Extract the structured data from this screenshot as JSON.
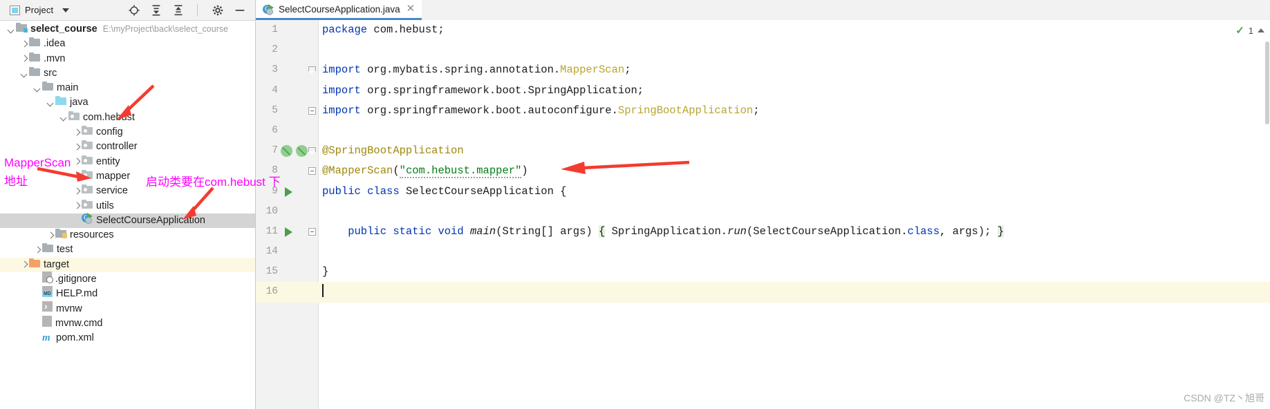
{
  "project_panel": {
    "toolbar": {
      "title": "Project",
      "dropdown_icon": "chevron-down-icon",
      "buttons": [
        {
          "name": "locate-icon",
          "label": "Select Opened File"
        },
        {
          "name": "expand-all-icon",
          "label": "Expand All"
        },
        {
          "name": "collapse-all-icon",
          "label": "Collapse All"
        },
        {
          "name": "settings-gear-icon",
          "label": "Settings"
        },
        {
          "name": "hide-icon",
          "label": "Hide"
        }
      ]
    },
    "tree": [
      {
        "label": "select_course",
        "path": "E:\\myProject\\back\\select_course",
        "indent": 0,
        "twisty": "down",
        "icon": "module-folder-icon",
        "bold": true,
        "state": "normal"
      },
      {
        "label": ".idea",
        "path": "",
        "indent": 1,
        "twisty": "right",
        "icon": "folder-icon",
        "bold": false,
        "state": "normal"
      },
      {
        "label": ".mvn",
        "path": "",
        "indent": 1,
        "twisty": "right",
        "icon": "folder-icon",
        "bold": false,
        "state": "normal"
      },
      {
        "label": "src",
        "path": "",
        "indent": 1,
        "twisty": "down",
        "icon": "folder-icon",
        "bold": false,
        "state": "normal"
      },
      {
        "label": "main",
        "path": "",
        "indent": 2,
        "twisty": "down",
        "icon": "folder-icon",
        "bold": false,
        "state": "normal"
      },
      {
        "label": "java",
        "path": "",
        "indent": 3,
        "twisty": "down",
        "icon": "source-root-folder-icon",
        "bold": false,
        "state": "normal"
      },
      {
        "label": "com.hebust",
        "path": "",
        "indent": 4,
        "twisty": "down",
        "icon": "package-icon",
        "bold": false,
        "state": "normal"
      },
      {
        "label": "config",
        "path": "",
        "indent": 5,
        "twisty": "right",
        "icon": "package-icon",
        "bold": false,
        "state": "normal"
      },
      {
        "label": "controller",
        "path": "",
        "indent": 5,
        "twisty": "right",
        "icon": "package-icon",
        "bold": false,
        "state": "normal"
      },
      {
        "label": "entity",
        "path": "",
        "indent": 5,
        "twisty": "right",
        "icon": "package-icon",
        "bold": false,
        "state": "normal"
      },
      {
        "label": "mapper",
        "path": "",
        "indent": 5,
        "twisty": "right",
        "icon": "package-icon",
        "bold": false,
        "state": "normal"
      },
      {
        "label": "service",
        "path": "",
        "indent": 5,
        "twisty": "right",
        "icon": "package-icon",
        "bold": false,
        "state": "normal"
      },
      {
        "label": "utils",
        "path": "",
        "indent": 5,
        "twisty": "right",
        "icon": "package-icon",
        "bold": false,
        "state": "normal"
      },
      {
        "label": "SelectCourseApplication",
        "path": "",
        "indent": 5,
        "twisty": "none",
        "icon": "java-class-runnable-icon",
        "bold": false,
        "state": "selected"
      },
      {
        "label": "resources",
        "path": "",
        "indent": 3,
        "twisty": "right",
        "icon": "resources-folder-icon",
        "bold": false,
        "state": "normal"
      },
      {
        "label": "test",
        "path": "",
        "indent": 2,
        "twisty": "right",
        "icon": "folder-icon",
        "bold": false,
        "state": "normal"
      },
      {
        "label": "target",
        "path": "",
        "indent": 1,
        "twisty": "right",
        "icon": "excluded-folder-icon",
        "bold": false,
        "state": "highlighted"
      },
      {
        "label": ".gitignore",
        "path": "",
        "indent": 2,
        "twisty": "none",
        "icon": "gitignore-file-icon",
        "bold": false,
        "state": "normal"
      },
      {
        "label": "HELP.md",
        "path": "",
        "indent": 2,
        "twisty": "none",
        "icon": "markdown-file-icon",
        "bold": false,
        "state": "normal"
      },
      {
        "label": "mvnw",
        "path": "",
        "indent": 2,
        "twisty": "none",
        "icon": "shell-script-icon",
        "bold": false,
        "state": "normal"
      },
      {
        "label": "mvnw.cmd",
        "path": "",
        "indent": 2,
        "twisty": "none",
        "icon": "cmd-file-icon",
        "bold": false,
        "state": "normal"
      },
      {
        "label": "pom.xml",
        "path": "",
        "indent": 2,
        "twisty": "none",
        "icon": "maven-pom-icon",
        "bold": false,
        "state": "normal"
      }
    ]
  },
  "annotations": {
    "color": "#ff00ff",
    "arrow_color": "#f43b2f",
    "notes": [
      {
        "id": "mapperscan-note-line1",
        "text": "MapperScan"
      },
      {
        "id": "mapperscan-note-line2",
        "text": "地址"
      },
      {
        "id": "startup-class-note",
        "text": "启动类要在com.hebust 下"
      }
    ]
  },
  "editor": {
    "tab": {
      "label": "SelectCourseApplication.java",
      "icon": "java-class-runnable-icon",
      "close_icon": "close-icon"
    },
    "inspection": {
      "check_icon": "inspection-ok-icon",
      "count": "1",
      "chevron_icon": "chevron-up-icon"
    },
    "lines": [
      {
        "num": "1",
        "gutter": [],
        "fold": "",
        "highlight": false,
        "tokens": [
          {
            "t": "package ",
            "c": "kw"
          },
          {
            "t": "com.hebust;",
            "c": "plain"
          }
        ]
      },
      {
        "num": "2",
        "gutter": [],
        "fold": "",
        "highlight": false,
        "tokens": []
      },
      {
        "num": "3",
        "gutter": [],
        "fold": "tri",
        "highlight": false,
        "tokens": [
          {
            "t": "import ",
            "c": "kw"
          },
          {
            "t": "org.mybatis.spring.annotation.",
            "c": "plain"
          },
          {
            "t": "MapperScan",
            "c": "cls"
          },
          {
            "t": ";",
            "c": "plain"
          }
        ]
      },
      {
        "num": "4",
        "gutter": [],
        "fold": "",
        "highlight": false,
        "tokens": [
          {
            "t": "import ",
            "c": "kw"
          },
          {
            "t": "org.springframework.boot.SpringApplication;",
            "c": "plain"
          }
        ]
      },
      {
        "num": "5",
        "gutter": [],
        "fold": "minus",
        "highlight": false,
        "tokens": [
          {
            "t": "import ",
            "c": "kw"
          },
          {
            "t": "org.springframework.boot.autoconfigure.",
            "c": "plain"
          },
          {
            "t": "SpringBootApplication",
            "c": "cls"
          },
          {
            "t": ";",
            "c": "plain"
          }
        ]
      },
      {
        "num": "6",
        "gutter": [],
        "fold": "",
        "highlight": false,
        "tokens": []
      },
      {
        "num": "7",
        "gutter": [
          "spring-bean-leaf-icon",
          "spring-config-leaf-icon"
        ],
        "fold": "tri",
        "highlight": false,
        "tokens": [
          {
            "t": "@SpringBootApplication",
            "c": "anno"
          }
        ]
      },
      {
        "num": "8",
        "gutter": [],
        "fold": "minus",
        "highlight": false,
        "tokens": [
          {
            "t": "@MapperScan",
            "c": "anno"
          },
          {
            "t": "(",
            "c": "plain"
          },
          {
            "t": "\"com.hebust.mapper\"",
            "c": "str"
          },
          {
            "t": ")",
            "c": "plain"
          }
        ]
      },
      {
        "num": "9",
        "gutter": [
          "run-class-icon"
        ],
        "fold": "",
        "highlight": false,
        "tokens": [
          {
            "t": "public ",
            "c": "kw"
          },
          {
            "t": "class ",
            "c": "kw"
          },
          {
            "t": "SelectCourseApplication {",
            "c": "plain"
          }
        ]
      },
      {
        "num": "10",
        "gutter": [],
        "fold": "",
        "highlight": false,
        "tokens": []
      },
      {
        "num": "11",
        "gutter": [
          "run-method-icon"
        ],
        "fold": "plus",
        "highlight": false,
        "tokens": [
          {
            "t": "    public ",
            "c": "kw"
          },
          {
            "t": "static ",
            "c": "kw"
          },
          {
            "t": "void ",
            "c": "kw"
          },
          {
            "t": "main",
            "c": "meth"
          },
          {
            "t": "(String[] args) ",
            "c": "plain"
          },
          {
            "t": "{",
            "c": "brace"
          },
          {
            "t": " SpringApplication.",
            "c": "plain"
          },
          {
            "t": "run",
            "c": "meth"
          },
          {
            "t": "(SelectCourseApplication.",
            "c": "plain"
          },
          {
            "t": "class",
            "c": "kw"
          },
          {
            "t": ", args); ",
            "c": "plain"
          },
          {
            "t": "}",
            "c": "brace"
          }
        ]
      },
      {
        "num": "14",
        "gutter": [],
        "fold": "",
        "highlight": false,
        "tokens": []
      },
      {
        "num": "15",
        "gutter": [],
        "fold": "",
        "highlight": false,
        "tokens": [
          {
            "t": "}",
            "c": "plain"
          }
        ]
      },
      {
        "num": "16",
        "gutter": [],
        "fold": "",
        "highlight": true,
        "tokens": [
          {
            "t": "",
            "c": "caret"
          }
        ]
      }
    ]
  },
  "watermark": {
    "text": "CSDN @TZ丶旭哥"
  }
}
